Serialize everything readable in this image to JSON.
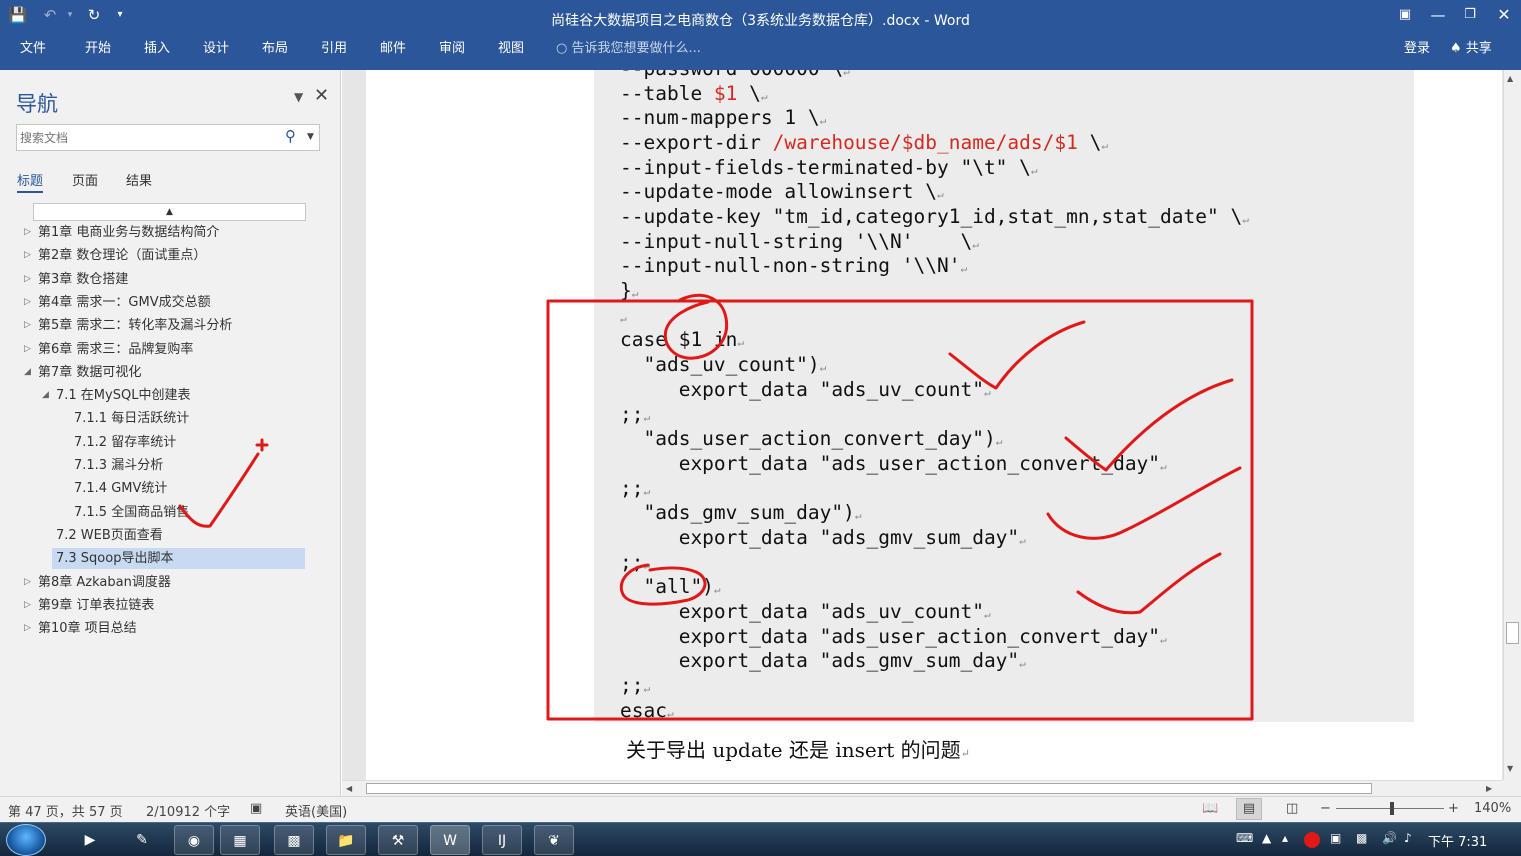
{
  "window": {
    "title": "尚硅谷大数据项目之电商数仓（3系统业务数据仓库）.docx - Word",
    "qat": {
      "save_icon": "save-icon",
      "undo_icon": "undo-icon",
      "redo_icon": "redo-icon",
      "customize_icon": "customize-icon"
    },
    "controls": {
      "ribbon_display": "ribbon-display-options-icon",
      "minimize": "minimize-icon",
      "restore": "restore-icon",
      "close": "close-icon"
    }
  },
  "ribbon": {
    "tabs": [
      "文件",
      "开始",
      "插入",
      "设计",
      "布局",
      "引用",
      "邮件",
      "审阅",
      "视图"
    ],
    "tell_me": "告诉我您想要做什么...",
    "login": "登录",
    "share": "共享"
  },
  "nav": {
    "title": "导航",
    "search_placeholder": "搜索文档",
    "tabs": [
      "标题",
      "页面",
      "结果"
    ],
    "headings": [
      {
        "text": "第1章 电商业务与数据结构简介",
        "level": 1,
        "state": "collapsed"
      },
      {
        "text": "第2章 数仓理论（面试重点）",
        "level": 1,
        "state": "collapsed"
      },
      {
        "text": "第3章 数仓搭建",
        "level": 1,
        "state": "collapsed"
      },
      {
        "text": "第4章 需求一：GMV成交总额",
        "level": 1,
        "state": "collapsed"
      },
      {
        "text": "第5章 需求二：转化率及漏斗分析",
        "level": 1,
        "state": "collapsed"
      },
      {
        "text": "第6章 需求三：品牌复购率",
        "level": 1,
        "state": "collapsed"
      },
      {
        "text": "第7章 数据可视化",
        "level": 1,
        "state": "expanded"
      },
      {
        "text": "7.1 在MySQL中创建表",
        "level": 2,
        "state": "expanded"
      },
      {
        "text": "7.1.1 每日活跃统计",
        "level": 3,
        "state": "leaf"
      },
      {
        "text": "7.1.2 留存率统计",
        "level": 3,
        "state": "leaf"
      },
      {
        "text": "7.1.3 漏斗分析",
        "level": 3,
        "state": "leaf"
      },
      {
        "text": "7.1.4  GMV统计",
        "level": 3,
        "state": "leaf"
      },
      {
        "text": "7.1.5 全国商品销售",
        "level": 3,
        "state": "leaf"
      },
      {
        "text": "7.2 WEB页面查看",
        "level": 2,
        "state": "leaf"
      },
      {
        "text": "7.3 Sqoop导出脚本",
        "level": 2,
        "state": "selected"
      },
      {
        "text": "第8章 Azkaban调度器",
        "level": 1,
        "state": "collapsed"
      },
      {
        "text": "第9章 订单表拉链表",
        "level": 1,
        "state": "collapsed"
      },
      {
        "text": "第10章 项目总结",
        "level": 1,
        "state": "collapsed"
      }
    ]
  },
  "document": {
    "code_lines": [
      {
        "text": "--password 000000 \\",
        "mark": "↵"
      },
      {
        "text": "--table ",
        "red": "$1",
        "tail": " \\",
        "mark": "↵"
      },
      {
        "text": "--num-mappers 1 \\",
        "mark": "↵"
      },
      {
        "text": "--export-dir ",
        "red": "/warehouse/$db_name/ads/$1",
        "tail": " \\",
        "mark": "↵"
      },
      {
        "text": "--input-fields-terminated-by \"\\t\" \\",
        "mark": "↵"
      },
      {
        "text": "--update-mode allowinsert \\",
        "mark": "↵"
      },
      {
        "text": "--update-key \"tm_id,category1_id,stat_mn,stat_date\" \\",
        "mark": "↵"
      },
      {
        "text": "--input-null-string '\\\\N'    \\",
        "mark": "↵"
      },
      {
        "text": "--input-null-non-string '\\\\N'",
        "mark": "↵"
      },
      {
        "text": "}",
        "mark": "↵"
      },
      {
        "text": "",
        "mark": "↵"
      },
      {
        "text": "case $1 in",
        "mark": "↵"
      },
      {
        "text": "  \"ads_uv_count\")",
        "mark": "↵"
      },
      {
        "text": "     export_data \"ads_uv_count\"",
        "mark": "↵"
      },
      {
        "text": ";;",
        "mark": "↵"
      },
      {
        "text": "  \"ads_user_action_convert_day\")",
        "mark": "↵"
      },
      {
        "text": "     export_data \"ads_user_action_convert_day\"",
        "mark": "↵"
      },
      {
        "text": ";;",
        "mark": "↵"
      },
      {
        "text": "  \"ads_gmv_sum_day\")",
        "mark": "↵"
      },
      {
        "text": "     export_data \"ads_gmv_sum_day\"",
        "mark": "↵"
      },
      {
        "text": ";;",
        "mark": "↵"
      },
      {
        "text": "  \"all\")",
        "mark": "↵"
      },
      {
        "text": "     export_data \"ads_uv_count\"",
        "mark": "↵"
      },
      {
        "text": "     export_data \"ads_user_action_convert_day\"",
        "mark": "↵"
      },
      {
        "text": "     export_data \"ads_gmv_sum_day\"",
        "mark": "↵"
      },
      {
        "text": ";;",
        "mark": "↵"
      },
      {
        "text": "esac",
        "mark": "↵"
      }
    ],
    "paragraph": "关于导出 update 还是 insert 的问题",
    "paragraph_mark": "↵"
  },
  "status": {
    "page": "第 47 页，共 57 页",
    "words": "2/10912 个字",
    "proofing_icon": "proofing-icon",
    "language": "英语(美国)",
    "read_mode_icon": "read-mode-icon",
    "print_layout_icon": "print-layout-icon",
    "web_layout_icon": "web-layout-icon",
    "zoom_out": "−",
    "zoom_in": "+",
    "zoom": "140%"
  },
  "taskbar": {
    "clock": "下午 7:31",
    "apps": [
      "start-orb-icon",
      "media-player-icon",
      "notepad-icon",
      "chrome-icon",
      "explorer-app-icon",
      "calculator-icon",
      "folder-icon",
      "tool-icon",
      "word-icon",
      "intellij-icon",
      "feather-icon"
    ]
  },
  "colors": {
    "word_blue": "#2b579a",
    "annotation_red": "#e01818",
    "code_red": "#d42a20",
    "nav_selected": "#c7daf2",
    "code_background": "#ececec"
  }
}
